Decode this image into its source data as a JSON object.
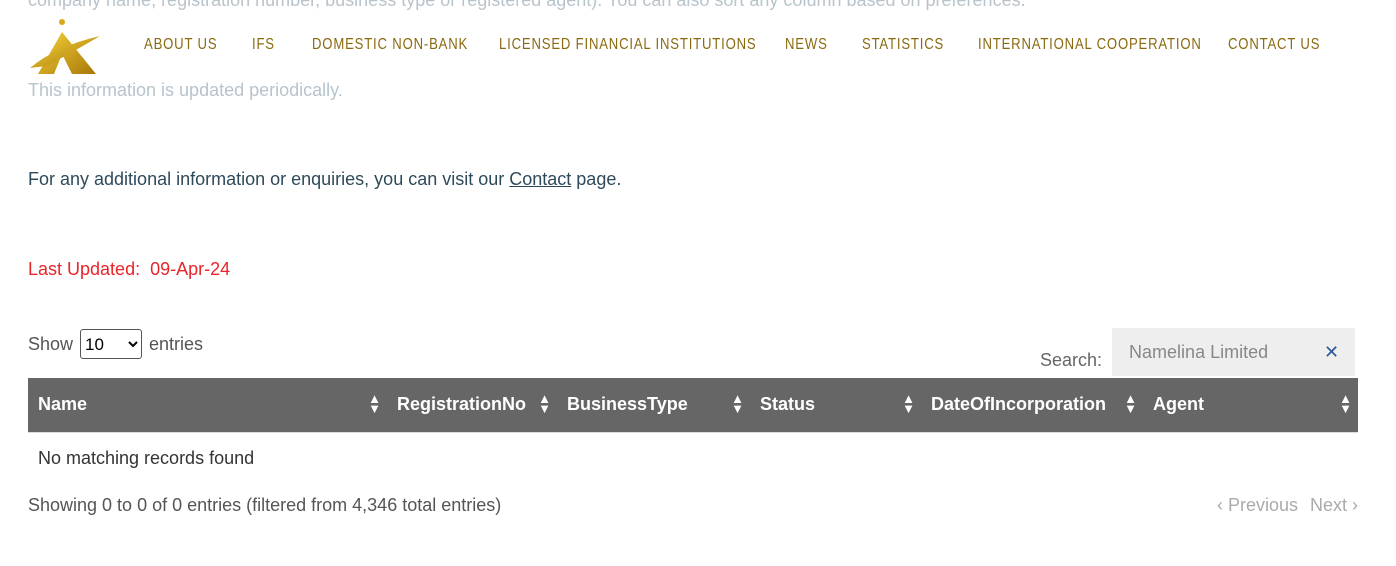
{
  "background_text": {
    "line1": "company name, registration number, business type or registered agent). You can also sort any column based on preferences.",
    "line2": "This information is updated periodically."
  },
  "nav": {
    "items": [
      "ABOUT US",
      "IFS",
      "DOMESTIC NON-BANK",
      "LICENSED FINANCIAL INSTITUTIONS",
      "NEWS",
      "STATISTICS",
      "INTERNATIONAL COOPERATION",
      "CONTACT US"
    ],
    "color": "#8a6a10"
  },
  "info": {
    "prefix": "For any additional information or enquiries, you can visit our ",
    "link": "Contact",
    "suffix": " page."
  },
  "last_updated": {
    "label": "Last Updated:",
    "value": "09-Apr-24"
  },
  "length": {
    "show": "Show",
    "value": "10",
    "entries": "entries"
  },
  "search": {
    "label": "Search:",
    "value": "Namelina Limited"
  },
  "table": {
    "columns": [
      "Name",
      "RegistrationNo",
      "BusinessType",
      "Status",
      "DateOfIncorporation",
      "Agent"
    ],
    "empty": "No matching records found"
  },
  "footer": {
    "info": "Showing 0 to 0 of 0 entries (filtered from 4,346 total entries)",
    "previous": "Previous",
    "next": "Next"
  }
}
